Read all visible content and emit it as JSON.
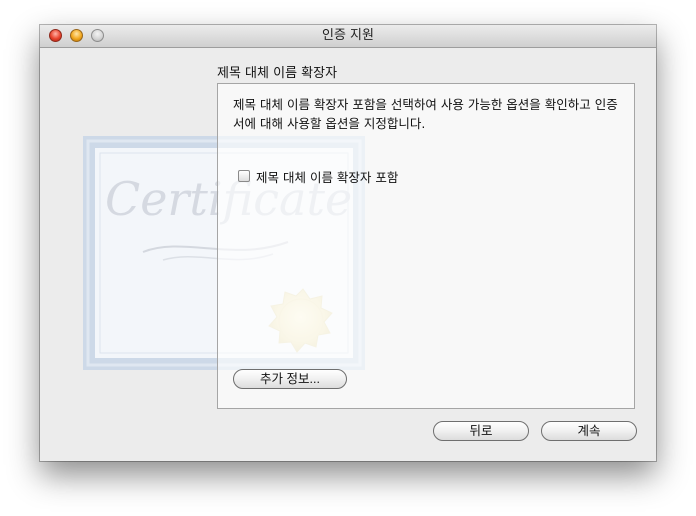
{
  "window": {
    "title": "인증 지원"
  },
  "page": {
    "section_title": "제목 대체 이름 확장자",
    "description": "제목 대체 이름 확장자 포함을 선택하여 사용 가능한 옵션을 확인하고 인증서에 대해 사용할 옵션을 지정합니다.",
    "checkbox": {
      "label": "제목 대체 이름 확장자 포함",
      "checked": false
    },
    "more_info_label": "추가 정보..."
  },
  "footer": {
    "back_label": "뒤로",
    "continue_label": "계속"
  },
  "artwork": {
    "certificate_word": "Certificate"
  }
}
